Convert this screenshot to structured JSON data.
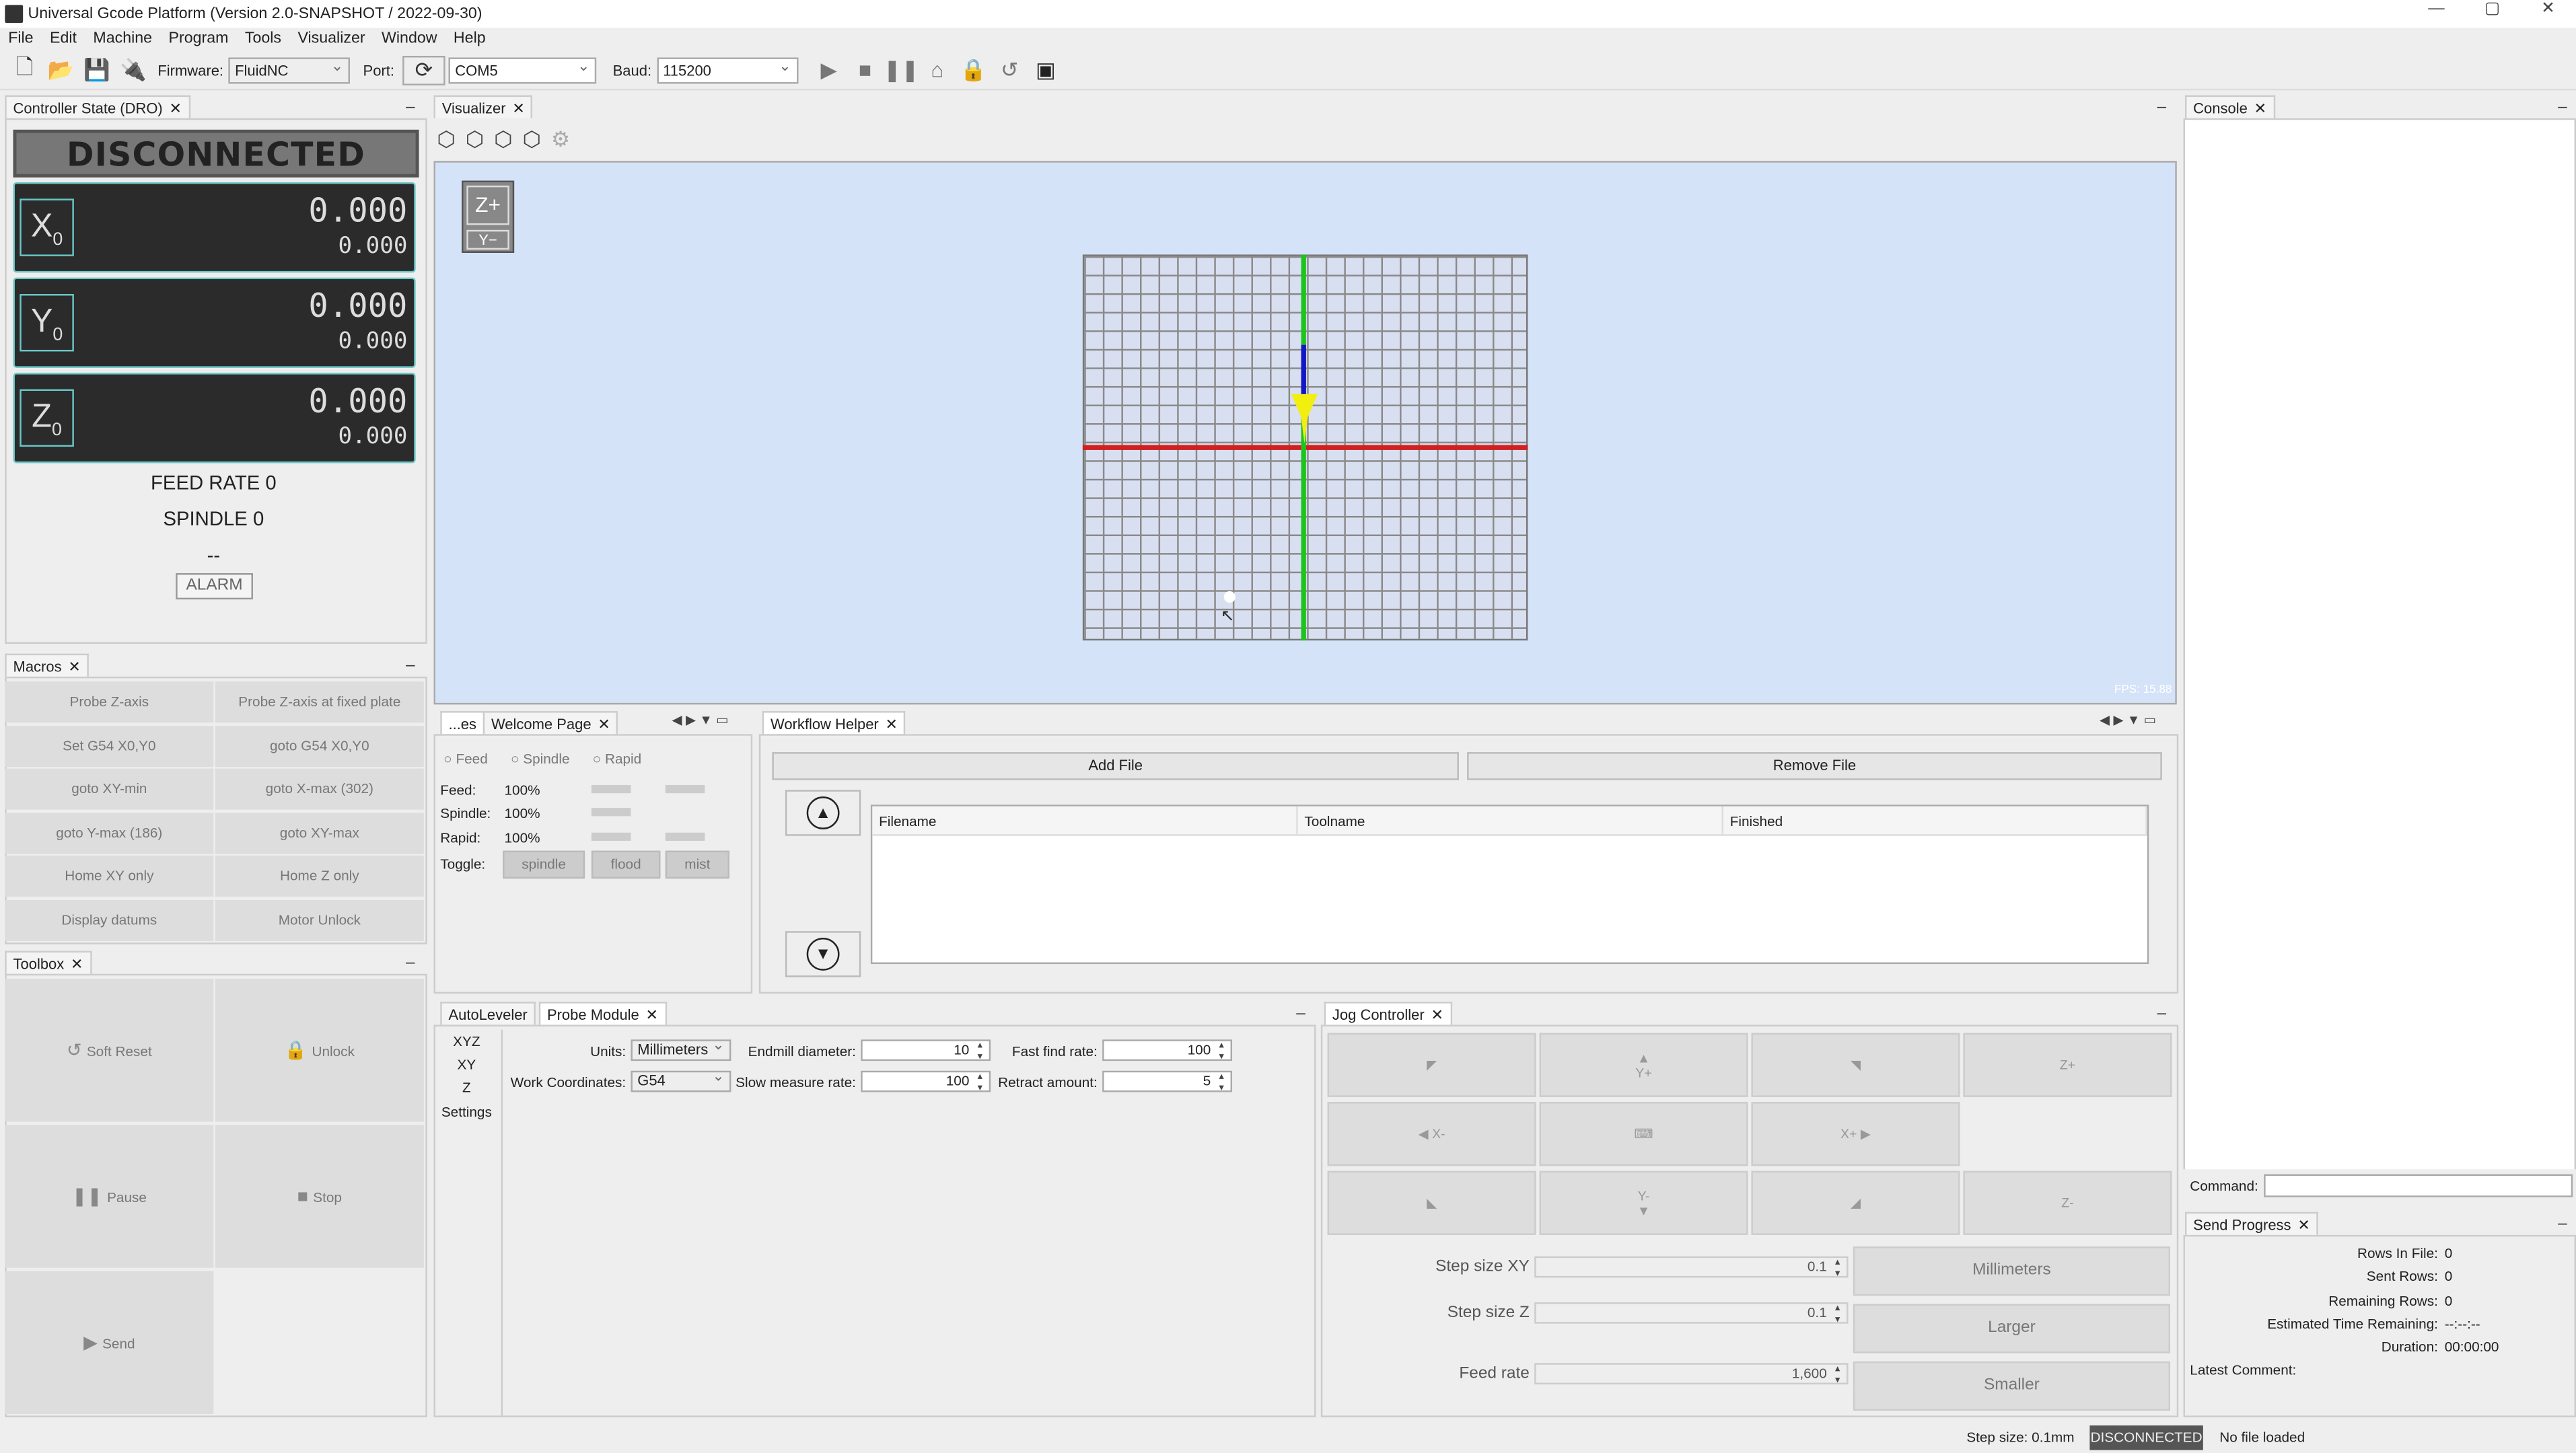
{
  "window": {
    "title": "Universal Gcode Platform (Version 2.0-SNAPSHOT / 2022-09-30)",
    "controls": [
      "—",
      "▢",
      "✕"
    ]
  },
  "menu": [
    "File",
    "Edit",
    "Machine",
    "Program",
    "Tools",
    "Visualizer",
    "Window",
    "Help"
  ],
  "toolbar": {
    "firmware_label": "Firmware:",
    "firmware_value": "FluidNC",
    "port_label": "Port:",
    "port_value": "COM5",
    "baud_label": "Baud:",
    "baud_value": "115200"
  },
  "dro": {
    "tab": "Controller State (DRO)",
    "state": "DISCONNECTED",
    "axes": [
      {
        "letter": "X",
        "sub": "0",
        "work": "0.000",
        "machine": "0.000"
      },
      {
        "letter": "Y",
        "sub": "0",
        "work": "0.000",
        "machine": "0.000"
      },
      {
        "letter": "Z",
        "sub": "0",
        "work": "0.000",
        "machine": "0.000"
      }
    ],
    "feed_rate": "FEED RATE 0",
    "spindle": "SPINDLE 0",
    "pins": "--",
    "alarm": "ALARM"
  },
  "macros": {
    "tab": "Macros",
    "items": [
      "Probe Z-axis",
      "Probe Z-axis at fixed plate",
      "Set G54 X0,Y0",
      "goto G54 X0,Y0",
      "goto XY-min",
      "goto X-max (302)",
      "goto Y-max (186)",
      "goto XY-max",
      "Home XY only",
      "Home Z only",
      "Display datums",
      "Motor Unlock"
    ]
  },
  "toolbox": {
    "tab": "Toolbox",
    "soft_reset": "Soft Reset",
    "unlock": "Unlock",
    "pause": "Pause",
    "stop": "Stop",
    "send": "Send"
  },
  "visualizer": {
    "tab": "Visualizer",
    "view_top": "Z+",
    "view_bottom": "Y−",
    "fps": "FPS: 15.88"
  },
  "overrides": {
    "tab_short": "...es",
    "tab_welcome": "Welcome Page",
    "radio": [
      "Feed",
      "Spindle",
      "Rapid"
    ],
    "rows": [
      {
        "label": "Feed:",
        "value": "100%"
      },
      {
        "label": "Spindle:",
        "value": "100%"
      },
      {
        "label": "Rapid:",
        "value": "100%"
      }
    ],
    "toggle_label": "Toggle:",
    "toggles": [
      "spindle",
      "flood",
      "mist"
    ]
  },
  "workflow": {
    "tab": "Workflow Helper",
    "add_file": "Add File",
    "remove_file": "Remove File",
    "columns": [
      "Filename",
      "Toolname",
      "Finished"
    ]
  },
  "probe": {
    "tab_auto": "AutoLeveler",
    "tab_probe": "Probe Module",
    "side": [
      "XYZ",
      "XY",
      "Z",
      "Settings"
    ],
    "units_label": "Units:",
    "units_value": "Millimeters",
    "wc_label": "Work Coordinates:",
    "wc_value": "G54",
    "endmill_label": "Endmill diameter:",
    "endmill_value": "10",
    "slow_label": "Slow measure rate:",
    "slow_value": "100",
    "fast_label": "Fast find rate:",
    "fast_value": "100",
    "retract_label": "Retract amount:",
    "retract_value": "5"
  },
  "jog": {
    "tab": "Jog Controller",
    "yplus": "Y+",
    "yminus": "Y-",
    "xplus": "X+",
    "xminus": "X-",
    "zplus": "Z+",
    "zminus": "Z-",
    "step_xy_label": "Step size XY",
    "step_xy_value": "0.1",
    "step_z_label": "Step size Z",
    "step_z_value": "0.1",
    "feed_label": "Feed rate",
    "feed_value": "1,600",
    "units_btn": "Millimeters",
    "larger": "Larger",
    "smaller": "Smaller"
  },
  "console": {
    "tab": "Console",
    "command_label": "Command:"
  },
  "send_progress": {
    "tab": "Send Progress",
    "rows": [
      {
        "label": "Rows In File:",
        "value": "0"
      },
      {
        "label": "Sent Rows:",
        "value": "0"
      },
      {
        "label": "Remaining Rows:",
        "value": "0"
      },
      {
        "label": "Estimated Time Remaining:",
        "value": "--:--:--"
      },
      {
        "label": "Duration:",
        "value": "00:00:00"
      }
    ],
    "latest_comment": "Latest Comment:"
  },
  "status_bar": {
    "step_size": "Step size: 0.1mm",
    "state": "DISCONNECTED",
    "file": "No file loaded"
  },
  "colors": {
    "x_axis": "#d22020",
    "y_axis": "#1ec41e",
    "z_axis": "#1515c8",
    "tool": "#f2ee10",
    "vis_bg": "#d5e3f8",
    "dro_bg": "#2b2b2b",
    "dro_accent": "#6ac6c6"
  }
}
